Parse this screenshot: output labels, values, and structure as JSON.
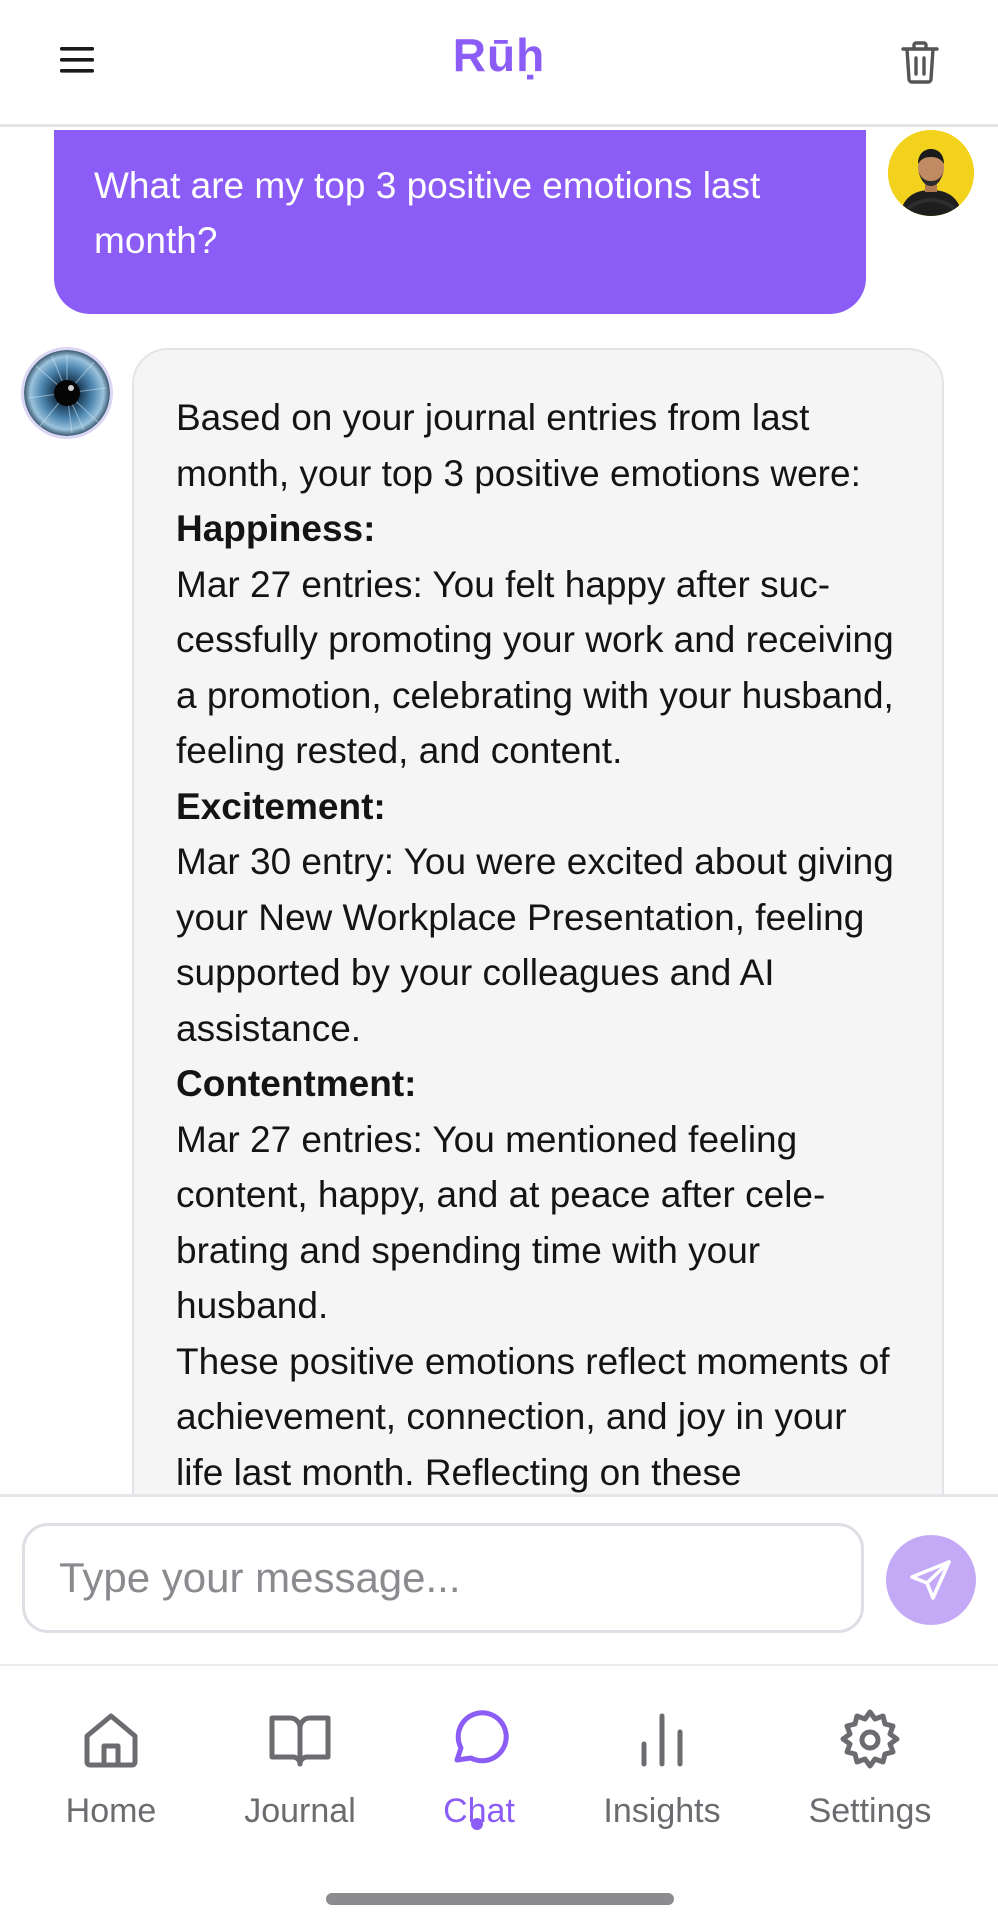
{
  "header": {
    "title": "Rūḥ",
    "menu_icon": "hamburger-menu-icon",
    "trash_icon": "trash-icon"
  },
  "messages": {
    "user": {
      "text": "What are my top 3 positive emotions last month?"
    },
    "assistant": {
      "intro": "Based on your journal entries from last month, your top 3 positive emotions were:",
      "sections": [
        {
          "heading": "Happiness:",
          "body": "Mar 27 entries: You felt happy after suc­cessfully promoting your work and receiv­ing a promotion, celebrating with your husband, feeling rested, and content."
        },
        {
          "heading": "Excitement:",
          "body": "Mar 30 entry: You were excited about giv­ing your New Workplace Presentation, feeling supported by your colleagues and AI assistance."
        },
        {
          "heading": "Contentment:",
          "body": "Mar 27 entries: You mentioned feeling content, happy, and at peace after cele­brating and spending time with your husband."
        }
      ],
      "outro": "These positive emotions reflect moments of achievement, connection, and joy in your life last month. Reflecting on these"
    }
  },
  "composer": {
    "placeholder": "Type your message...",
    "send_icon": "send-icon"
  },
  "nav": {
    "items": [
      {
        "label": "Home",
        "icon": "home-icon"
      },
      {
        "label": "Journal",
        "icon": "book-icon"
      },
      {
        "label": "Chat",
        "icon": "chat-bubble-icon",
        "active": true
      },
      {
        "label": "Insights",
        "icon": "bar-chart-icon"
      },
      {
        "label": "Settings",
        "icon": "gear-icon"
      }
    ]
  },
  "colors": {
    "accent": "#8b5cf6",
    "send_button": "#c4aaf6",
    "assistant_bubble": "#f5f5f6"
  }
}
